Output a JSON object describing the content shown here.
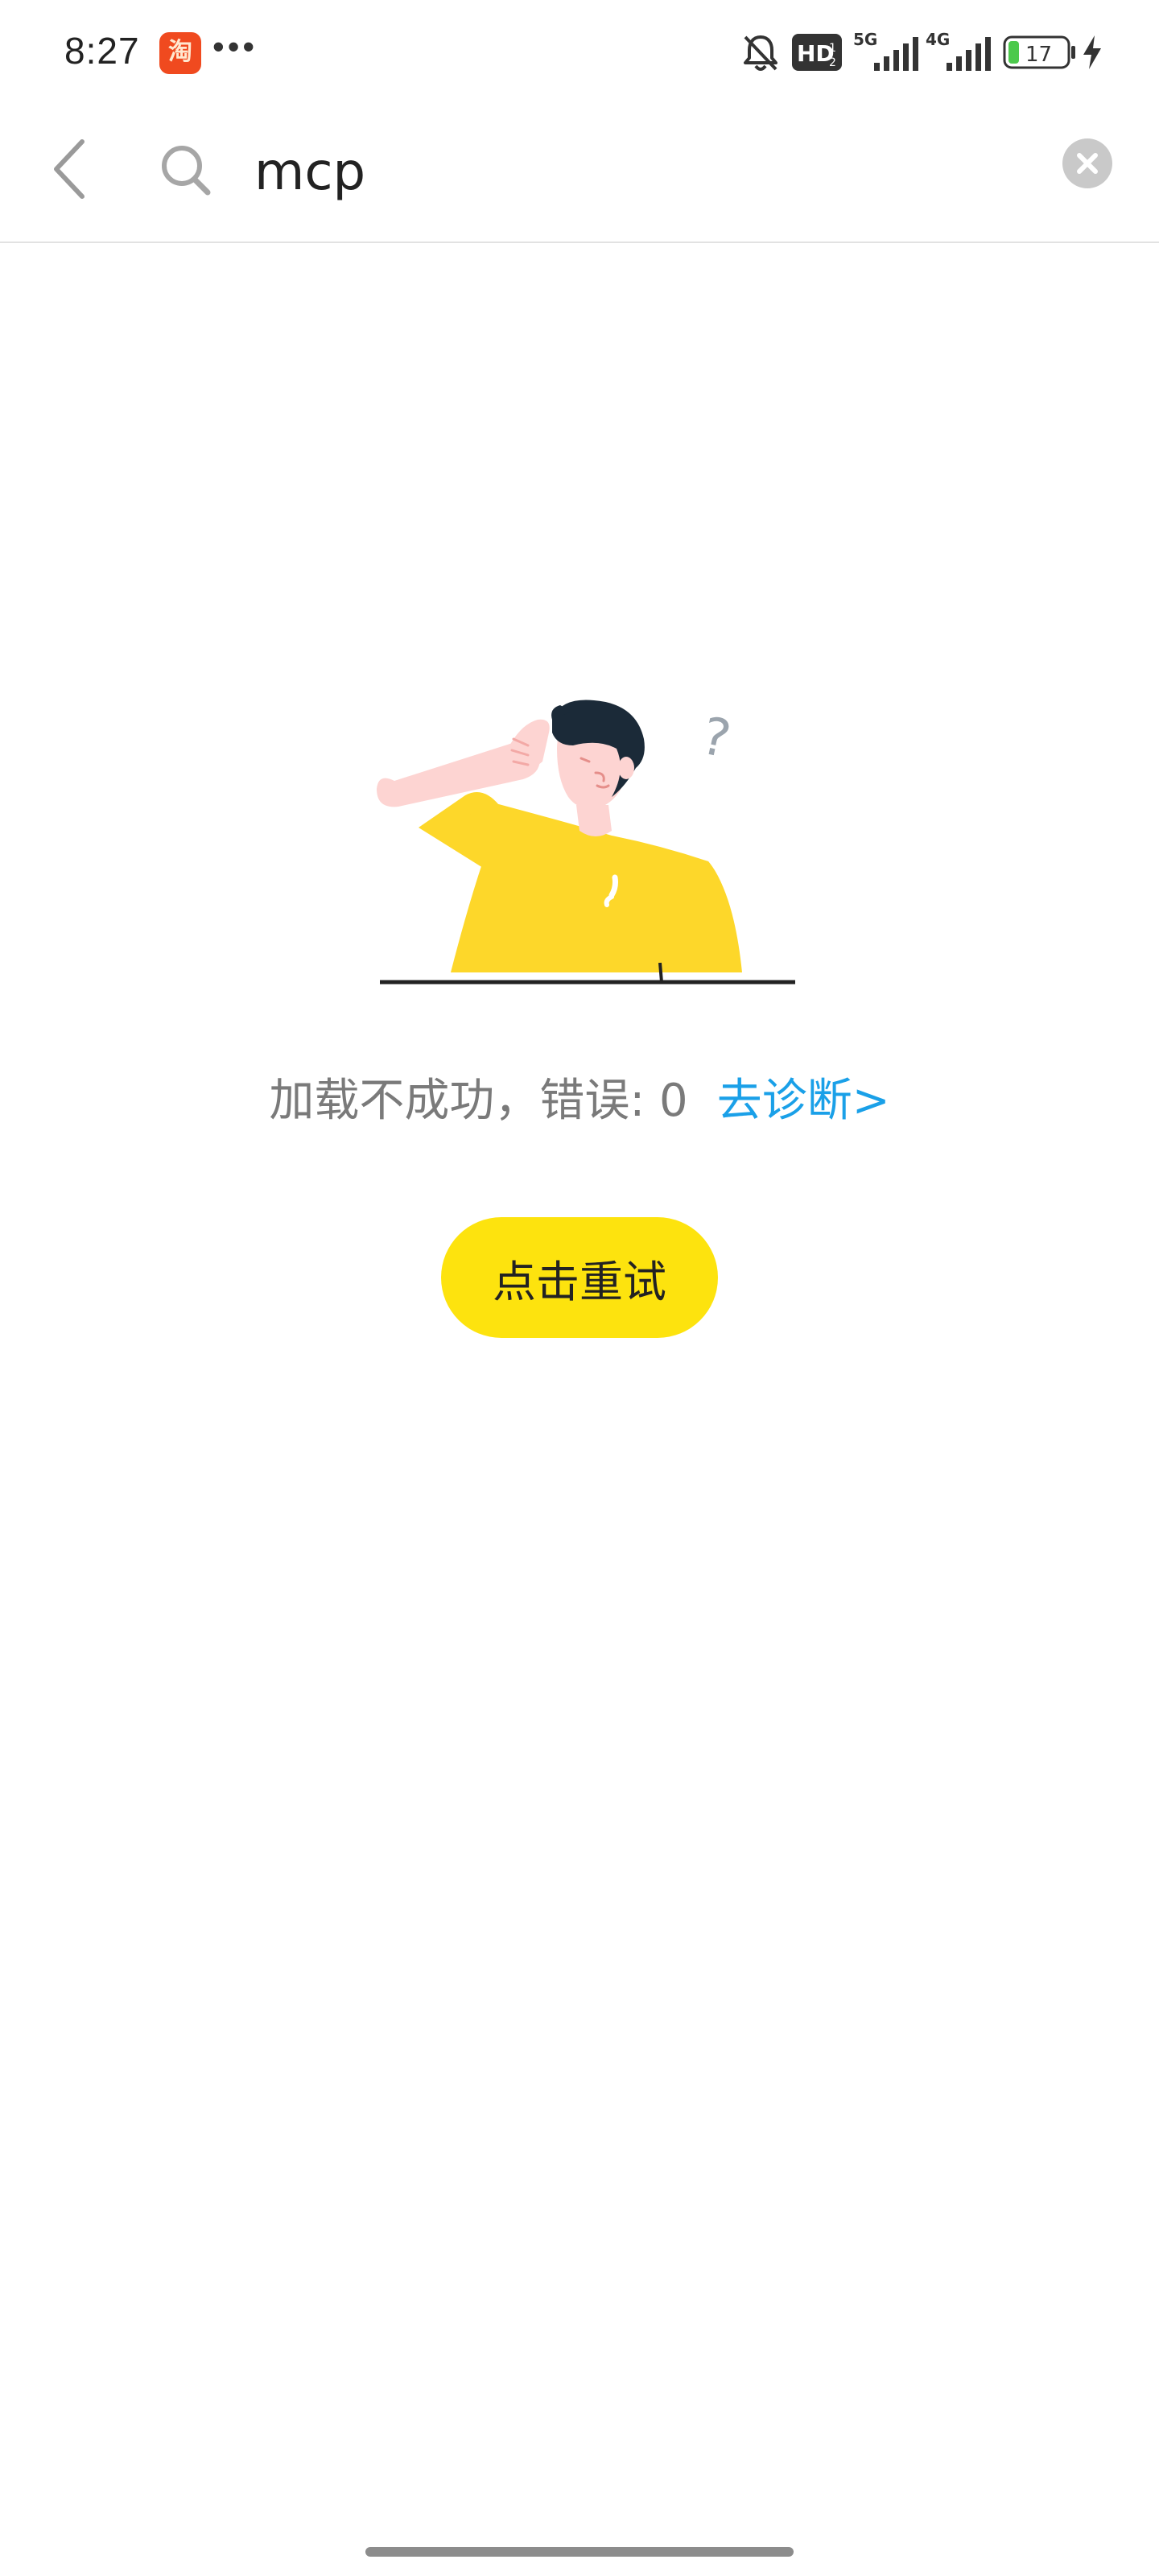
{
  "status_bar": {
    "time": "8:27",
    "app_badge_text": "淘",
    "more_indicator": "•••",
    "network_1": "5G",
    "network_2": "4G",
    "hd_label": "HD",
    "battery_level": "17",
    "icons": [
      "mute-bell-icon",
      "hd-icon",
      "signal-icon",
      "battery-icon",
      "charging-icon"
    ]
  },
  "search": {
    "query": "mcp",
    "icons": [
      "back-arrow-icon",
      "search-icon",
      "clear-icon"
    ]
  },
  "error": {
    "message": "加载不成功，错误: 0",
    "diagnose_link": "去诊断>",
    "retry_label": "点击重试",
    "illustration_mark": "?"
  },
  "colors": {
    "link": "#1aa0e8",
    "retry_button": "#fde30e",
    "message_text": "#7a7a7a",
    "shirt": "#fdd72a",
    "skin": "#fdd4d2",
    "hair": "#1b2a38"
  }
}
